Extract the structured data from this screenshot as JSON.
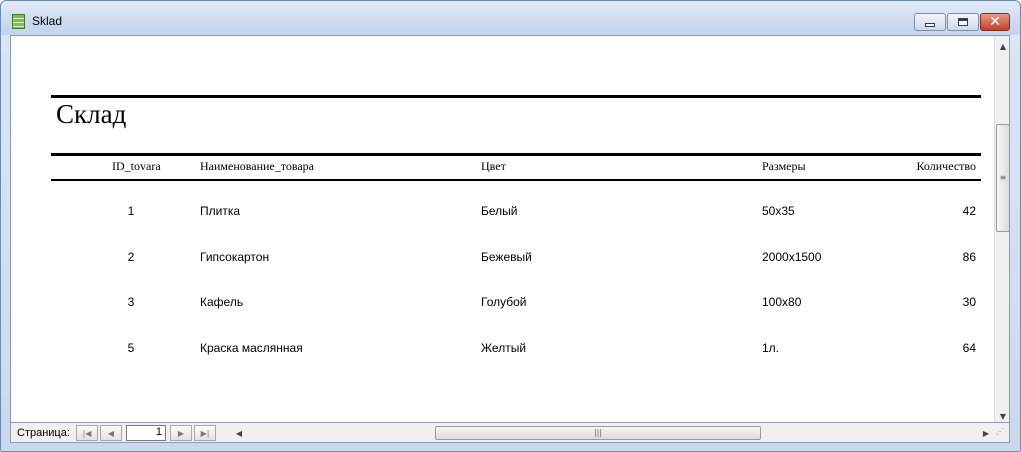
{
  "window": {
    "title": "Sklad",
    "icon": "table-icon",
    "controls": {
      "minimize": "minimize-icon",
      "maximize": "maximize-icon",
      "close": "close-icon"
    }
  },
  "report": {
    "title": "Склад",
    "columns": [
      "ID_tovara",
      "Наименование_товара",
      "Цвет",
      "Размеры",
      "Количество"
    ],
    "rows": [
      {
        "id": "1",
        "name": "Плитка",
        "color": "Белый",
        "size": "50x35",
        "qty": "42"
      },
      {
        "id": "2",
        "name": "Гипсокартон",
        "color": "Бежевый",
        "size": "2000x1500",
        "qty": "86"
      },
      {
        "id": "3",
        "name": "Кафель",
        "color": "Голубой",
        "size": "100x80",
        "qty": "30"
      },
      {
        "id": "5",
        "name": "Краска маслянная",
        "color": "Желтый",
        "size": "1л.",
        "qty": "64"
      }
    ]
  },
  "navigation": {
    "page_label": "Страница:",
    "page_value": "1",
    "icons": [
      "first-record-icon",
      "prev-record-icon",
      "next-record-icon",
      "last-record-icon"
    ]
  },
  "colors": {
    "title_bar": "#cfdcf0",
    "close_button": "#c0412a",
    "rules": "#000000"
  }
}
